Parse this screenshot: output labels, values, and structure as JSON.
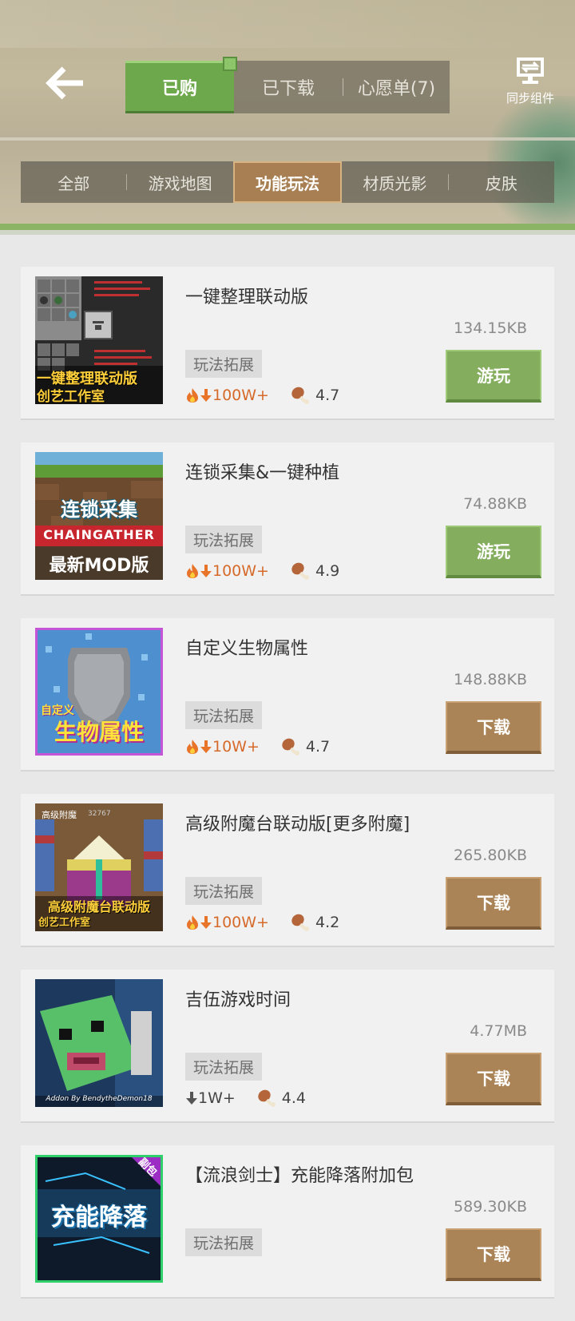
{
  "header": {
    "tabs": [
      {
        "label": "已购",
        "active": true
      },
      {
        "label": "已下载",
        "active": false
      },
      {
        "label": "心愿单(7)",
        "active": false
      }
    ],
    "sync_label": "同步组件"
  },
  "categories": [
    {
      "label": "全部",
      "active": false
    },
    {
      "label": "游戏地图",
      "active": false
    },
    {
      "label": "功能玩法",
      "active": true
    },
    {
      "label": "材质光影",
      "active": false
    },
    {
      "label": "皮肤",
      "active": false
    }
  ],
  "items": [
    {
      "title": "一键整理联动版",
      "size": "134.15KB",
      "tag": "玩法拓展",
      "hot": true,
      "downloads": "100W+",
      "rating": "4.7",
      "button": "游玩",
      "button_type": "play",
      "thumb_text": [
        "一键整理联动版",
        "创艺工作室"
      ]
    },
    {
      "title": "连锁采集&一键种植",
      "size": "74.88KB",
      "tag": "玩法拓展",
      "hot": true,
      "downloads": "100W+",
      "rating": "4.9",
      "button": "游玩",
      "button_type": "play",
      "thumb_text": [
        "连锁采集",
        "CHAINGATHER",
        "最新MOD版"
      ]
    },
    {
      "title": "自定义生物属性",
      "size": "148.88KB",
      "tag": "玩法拓展",
      "hot": true,
      "downloads": "10W+",
      "rating": "4.7",
      "button": "下载",
      "button_type": "download",
      "thumb_text": [
        "自定义",
        "生物属性"
      ]
    },
    {
      "title": "高级附魔台联动版[更多附魔]",
      "size": "265.80KB",
      "tag": "玩法拓展",
      "hot": true,
      "downloads": "100W+",
      "rating": "4.2",
      "button": "下载",
      "button_type": "download",
      "thumb_text": [
        "高级附魔",
        "32767",
        "高级附魔台联动版",
        "创艺工作室"
      ]
    },
    {
      "title": "吉伍游戏时间",
      "size": "4.77MB",
      "tag": "玩法拓展",
      "hot": false,
      "downloads": "1W+",
      "rating": "4.4",
      "button": "下载",
      "button_type": "download",
      "thumb_text": [
        "Addon By BendytheDemon18"
      ]
    },
    {
      "title": "【流浪剑士】充能降落附加包",
      "size": "589.30KB",
      "tag": "玩法拓展",
      "hot": false,
      "downloads": "",
      "rating": "",
      "button": "下载",
      "button_type": "download",
      "thumb_text": [
        "充能降落",
        "副包"
      ]
    }
  ],
  "colors": {
    "play_button": "#84ad5e",
    "download_button": "#aa8457",
    "active_tab": "#6ea84d",
    "active_category": "#a77f52",
    "hot_icon": "#e8742a"
  }
}
